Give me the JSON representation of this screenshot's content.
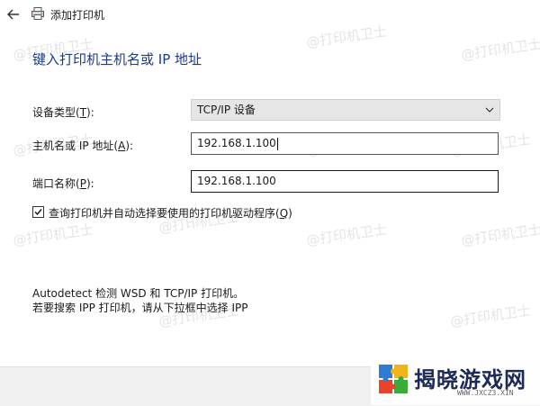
{
  "window": {
    "title": "添加打印机"
  },
  "heading": "键入打印机主机名或 IP 地址",
  "form": {
    "device_type": {
      "label_pre": "设备类型(",
      "label_key": "T",
      "label_post": "):",
      "value": "TCP/IP 设备"
    },
    "hostname": {
      "label_pre": "主机名或 IP 地址(",
      "label_key": "A",
      "label_post": "):",
      "value": "192.168.1.100"
    },
    "port": {
      "label_pre": "端口名称(",
      "label_key": "P",
      "label_post": "):",
      "value": "192.168.1.100"
    },
    "query_driver": {
      "checked": true,
      "label_pre": "查询打印机并自动选择要使用的打印机驱动程序(",
      "label_key": "Q",
      "label_post": ")"
    }
  },
  "info": {
    "line1": "Autodetect 检测 WSD 和 TCP/IP 打印机。",
    "line2": "若要搜索 IPP 打印机，请从下拉框中选择 IPP"
  },
  "watermark": {
    "text": "@打印机卫士"
  },
  "brand": {
    "name": "揭晓游戏网",
    "url": "WWW.JXCZ3.XIN"
  },
  "colors": {
    "heading": "#1a3a8a",
    "footer_bg": "#f0f0f0",
    "select_bg": "#e6e6e6"
  },
  "icons": {
    "back": "arrow-left-icon",
    "printer": "printer-icon",
    "chevron": "chevron-down-icon",
    "check": "checkmark-icon"
  }
}
